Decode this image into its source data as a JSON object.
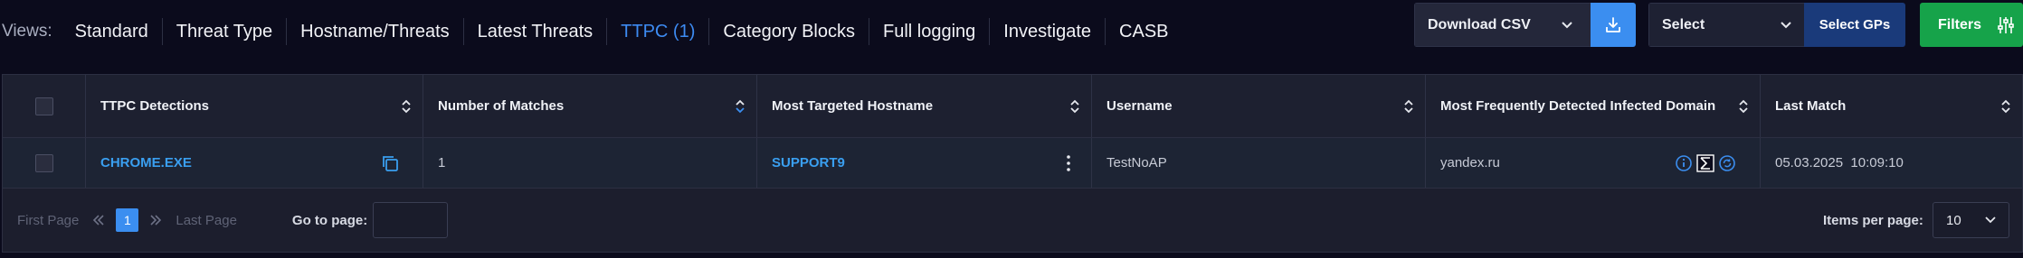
{
  "views": {
    "label": "Views:",
    "tabs": [
      {
        "label": "Standard"
      },
      {
        "label": "Threat Type"
      },
      {
        "label": "Hostname/Threats"
      },
      {
        "label": "Latest Threats"
      },
      {
        "label": "TTPC (1)",
        "active": true
      },
      {
        "label": "Category Blocks"
      },
      {
        "label": "Full logging"
      },
      {
        "label": "Investigate"
      },
      {
        "label": "CASB"
      }
    ]
  },
  "toolbar": {
    "download_csv_label": "Download CSV",
    "gp_select_value": "Select",
    "select_gps_label": "Select GPs",
    "filters_label": "Filters"
  },
  "table": {
    "headers": [
      "TTPC Detections",
      "Number of Matches",
      "Most Targeted Hostname",
      "Username",
      "Most Frequently Detected Infected Domain",
      "Last Match"
    ],
    "rows": [
      {
        "detection": "CHROME.EXE",
        "matches": "1",
        "hostname": "SUPPORT9",
        "username": "TestNoAP",
        "domain": "yandex.ru",
        "last_match": "05.03.2025  10:09:10"
      }
    ]
  },
  "pagination": {
    "first_page": "First Page",
    "last_page": "Last Page",
    "current_page": "1",
    "go_to_label": "Go to page:",
    "items_per_page_label": "Items per page:",
    "items_per_page_value": "10"
  },
  "colors": {
    "accent": "#3b8ef0",
    "filters": "#16a34a",
    "select_gps": "#1a3a7a",
    "link": "#3a9ff0"
  }
}
